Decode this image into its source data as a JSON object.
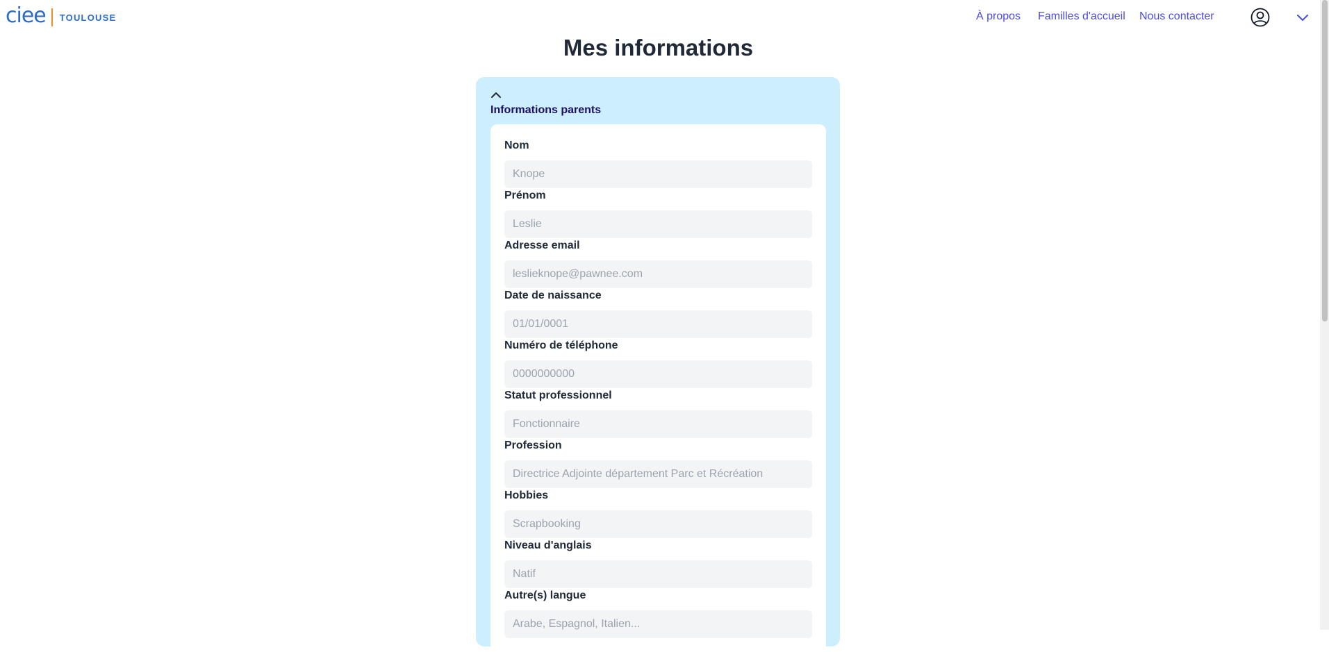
{
  "header": {
    "logo": {
      "word": "ciee",
      "city": "TOULOUSE"
    },
    "nav": [
      {
        "label": "À propos"
      },
      {
        "label": "Familles d'accueil"
      },
      {
        "label": "Nous contacter"
      }
    ],
    "icons": {
      "user": "user-circle-icon",
      "menu": "chevron-down-icon"
    },
    "accent_color": "#4a4ae6"
  },
  "page": {
    "title": "Mes informations"
  },
  "section": {
    "title": "Informations parents",
    "collapse_icon": "chevron-up-icon",
    "fields": [
      {
        "label": "Nom",
        "placeholder": "Knope"
      },
      {
        "label": "Prénom",
        "placeholder": "Leslie"
      },
      {
        "label": "Adresse email",
        "placeholder": "leslieknope@pawnee.com"
      },
      {
        "label": "Date de naissance",
        "placeholder": "01/01/0001"
      },
      {
        "label": "Numéro de téléphone",
        "placeholder": "0000000000"
      },
      {
        "label": "Statut professionnel",
        "placeholder": "Fonctionnaire"
      },
      {
        "label": "Profession",
        "placeholder": "Directrice Adjointe département Parc et Récréation"
      },
      {
        "label": "Hobbies",
        "placeholder": "Scrapbooking"
      },
      {
        "label": "Niveau d'anglais",
        "placeholder": "Natif"
      },
      {
        "label": "Autre(s) langue",
        "placeholder": "Arabe, Espagnol, Italien..."
      }
    ]
  },
  "colors": {
    "card_background": "#cdeefd",
    "section_title": "#1a1064",
    "input_background": "#f3f4f6"
  }
}
